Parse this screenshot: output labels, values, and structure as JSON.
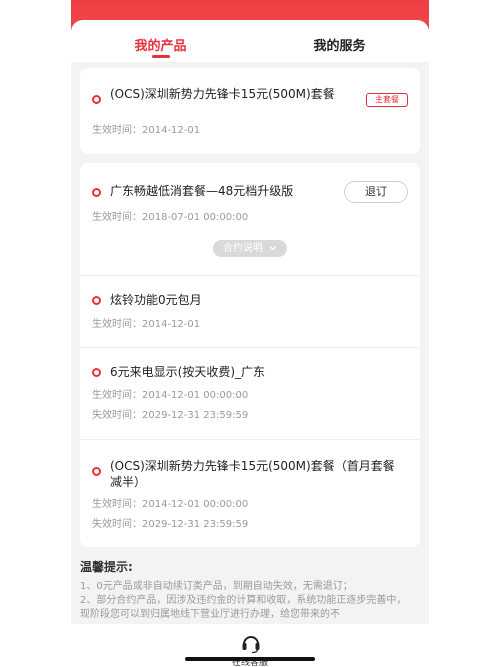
{
  "tabs": [
    {
      "label": "我的产品",
      "active": true
    },
    {
      "label": "我的服务",
      "active": false
    }
  ],
  "main_product": {
    "title": "(OCS)深圳新势力先锋卡15元(500M)套餐",
    "badge": "主套餐",
    "effective": "生效时间：2014-12-01"
  },
  "products": [
    {
      "title": "广东畅越低消套餐—48元档升级版",
      "action": "退订",
      "effective": "生效时间：2018-07-01 00:00:00",
      "contract_label": "合约说明",
      "contract_icon": "chevron-down-icon"
    },
    {
      "title": "炫铃功能0元包月",
      "effective": "生效时间：2014-12-01"
    },
    {
      "title": "6元来电显示(按天收费)_广东",
      "effective": "生效时间：2014-12-01 00:00:00",
      "expiry": "失效时间：2029-12-31 23:59:59"
    },
    {
      "title": "(OCS)深圳新势力先锋卡15元(500M)套餐（首月套餐减半）",
      "effective": "生效时间：2014-12-01 00:00:00",
      "expiry": "失效时间：2029-12-31 23:59:59"
    }
  ],
  "tips": {
    "title": "温馨提示:",
    "line1": "1、0元产品或非自动续订类产品，到期自动失效，无需退订；",
    "line2": "2、部分合约产品，因涉及违约金的计算和收取，系统功能正逐步完善中，现阶段您可以到归属地线下营业厅进行办理，给您带来的不"
  },
  "bottom": {
    "icon": "headset-icon",
    "label": "在线客服"
  },
  "colors": {
    "accent": "#e8313a",
    "header": "#ee3d42"
  }
}
